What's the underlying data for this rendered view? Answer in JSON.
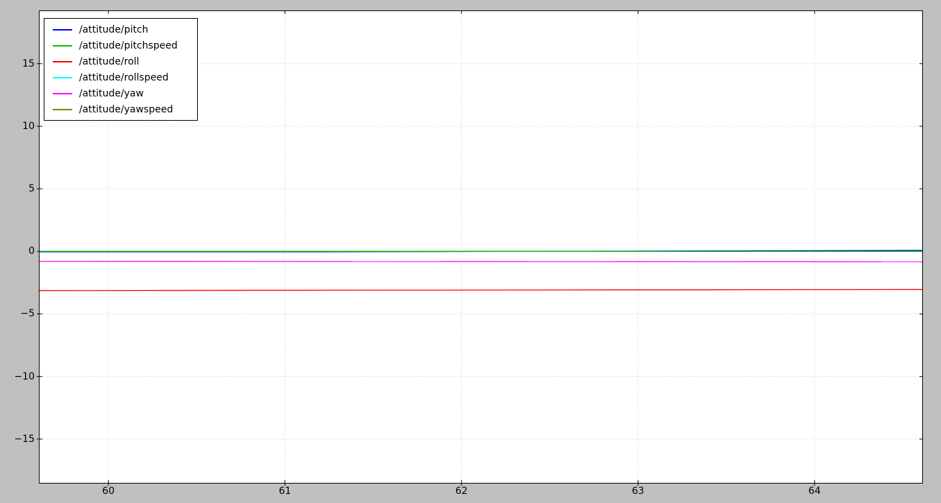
{
  "figure": {
    "background_color": "#c0c0c0",
    "plot_background_color": "#ffffff",
    "axis_color": "#000000",
    "grid_color": "#c8c8c8",
    "tick_label_color": "#000000"
  },
  "chart_data": {
    "type": "line",
    "title": "",
    "xlabel": "",
    "ylabel": "",
    "xlim": [
      59.61,
      64.61
    ],
    "ylim": [
      -18.5,
      19.2
    ],
    "x_ticks": [
      60,
      61,
      62,
      63,
      64
    ],
    "x_tick_labels": [
      "60",
      "61",
      "62",
      "63",
      "64"
    ],
    "y_ticks": [
      15,
      10,
      5,
      0,
      -5,
      -10,
      -15
    ],
    "y_tick_labels": [
      "15",
      "10",
      "5",
      "0",
      "−5",
      "−10",
      "−15"
    ],
    "grid": true,
    "grid_style": "dotted",
    "legend_position": "upper-left",
    "series": [
      {
        "name": "/attitude/pitch",
        "color": "#0000ff",
        "points": [
          [
            59.61,
            -0.04
          ],
          [
            61.2,
            -0.04
          ],
          [
            64.61,
            0.08
          ]
        ]
      },
      {
        "name": "/attitude/pitchspeed",
        "color": "#00c000",
        "points": [
          [
            59.61,
            0.0
          ],
          [
            64.61,
            0.0
          ]
        ]
      },
      {
        "name": "/attitude/roll",
        "color": "#ff0000",
        "points": [
          [
            59.61,
            -3.13
          ],
          [
            64.61,
            -3.05
          ]
        ]
      },
      {
        "name": "/attitude/rollspeed",
        "color": "#00ffff",
        "points": [
          [
            59.61,
            0.0
          ],
          [
            64.61,
            0.0
          ]
        ]
      },
      {
        "name": "/attitude/yaw",
        "color": "#ff00ff",
        "points": [
          [
            59.61,
            -0.79
          ],
          [
            64.61,
            -0.83
          ]
        ]
      },
      {
        "name": "/attitude/yawspeed",
        "color": "#808000",
        "points": [
          [
            59.61,
            0.0
          ],
          [
            64.61,
            0.0
          ]
        ]
      }
    ],
    "draw_order": [
      3,
      5,
      0,
      1,
      4,
      2
    ]
  }
}
